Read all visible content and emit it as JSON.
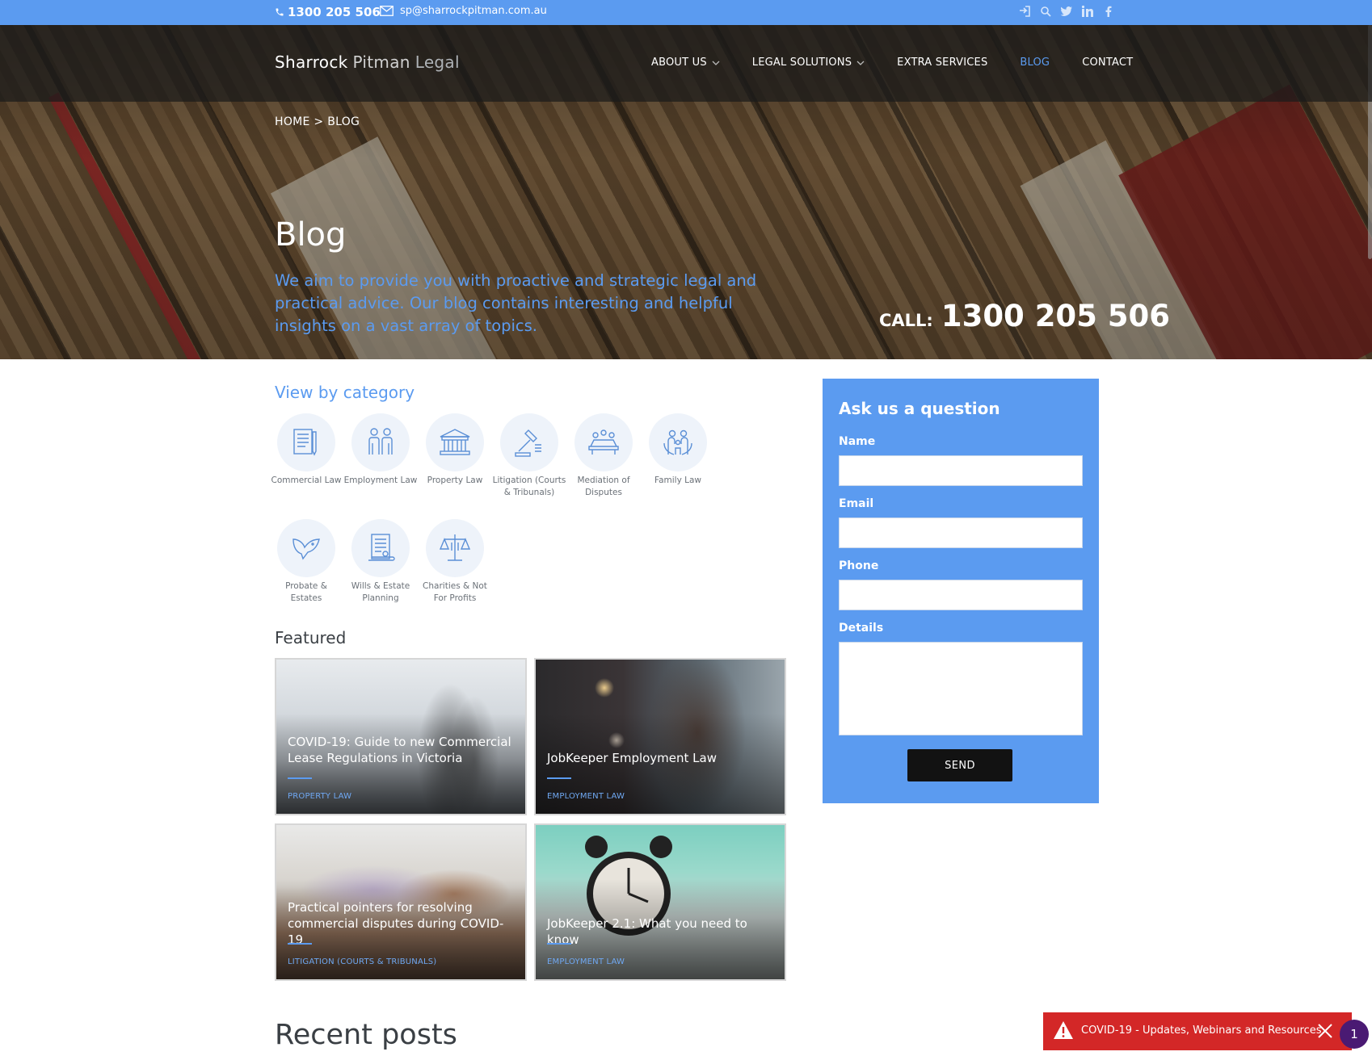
{
  "topbar": {
    "phone": "1300 205 506",
    "email": "sp@sharrockpitman.com.au",
    "socials": [
      "login-icon",
      "search-icon",
      "twitter-icon",
      "linkedin-icon",
      "facebook-icon"
    ]
  },
  "logo": {
    "word1": "Sharrock",
    "word2": "Pitman",
    "word3": "Legal"
  },
  "nav": {
    "items": [
      {
        "label": "ABOUT US",
        "dropdown": true
      },
      {
        "label": "LEGAL SOLUTIONS",
        "dropdown": true
      },
      {
        "label": "EXTRA SERVICES",
        "dropdown": false
      },
      {
        "label": "BLOG",
        "dropdown": false,
        "active": true
      },
      {
        "label": "CONTACT",
        "dropdown": false
      }
    ]
  },
  "breadcrumb": "HOME > BLOG",
  "hero": {
    "title": "Blog",
    "subtitle": "We aim to provide you with proactive and strategic legal and practical advice. Our blog contains interesting and helpful insights on a vast array of topics.",
    "call_label": "CALL:",
    "call_number": "1300 205 506"
  },
  "categories": {
    "heading": "View by category",
    "items": [
      {
        "label": "Commercial Law",
        "icon": "document-pen-icon"
      },
      {
        "label": "Employment Law",
        "icon": "people-icon"
      },
      {
        "label": "Property Law",
        "icon": "building-icon"
      },
      {
        "label": "Litigation (Courts & Tribunals)",
        "icon": "gavel-icon"
      },
      {
        "label": "Mediation of Disputes",
        "icon": "meeting-table-icon"
      },
      {
        "label": "Family Law",
        "icon": "family-icon"
      },
      {
        "label": "Probate & Estates",
        "icon": "dove-icon"
      },
      {
        "label": "Wills & Estate Planning",
        "icon": "will-scroll-icon"
      },
      {
        "label": "Charities & Not For Profits",
        "icon": "scales-icon"
      }
    ]
  },
  "featured": {
    "heading": "Featured",
    "posts": [
      {
        "title": "COVID-19: Guide to new Commercial Lease Regulations in Victoria",
        "tag": "PROPERTY LAW"
      },
      {
        "title": "JobKeeper Employment Law",
        "tag": "EMPLOYMENT LAW"
      },
      {
        "title": "Practical pointers for resolving commercial disputes during COVID-19",
        "tag": "LITIGATION (COURTS & TRIBUNALS)"
      },
      {
        "title": "JobKeeper 2.1: What you need to know",
        "tag": "EMPLOYMENT LAW"
      }
    ]
  },
  "recent_heading": "Recent posts",
  "form": {
    "heading": "Ask us a question",
    "name_label": "Name",
    "email_label": "Email",
    "phone_label": "Phone",
    "details_label": "Details",
    "send_label": "SEND"
  },
  "alert": {
    "message": "COVID-19 - Updates, Webinars and Resources",
    "badge_count": "1"
  },
  "colors": {
    "accent": "#5b9bf0",
    "alert": "#d32727",
    "dark": "#121212"
  }
}
